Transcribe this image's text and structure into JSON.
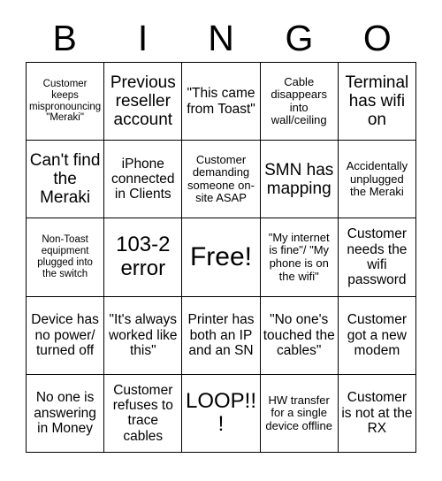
{
  "card": {
    "title_letters": [
      "B",
      "I",
      "N",
      "G",
      "O"
    ],
    "columns": 5,
    "rows": 5,
    "free_space_label": "Free!",
    "colors": {
      "background": "#ffffff",
      "text": "#000000",
      "gridline": "#000000"
    },
    "cells": [
      [
        {
          "text": "Customer keeps mispronouncing \"Meraki\"",
          "size": "xs"
        },
        {
          "text": "Previous reseller account",
          "size": "l"
        },
        {
          "text": "\"This came from Toast\"",
          "size": "m"
        },
        {
          "text": "Cable disappears into wall/ceiling",
          "size": "s"
        },
        {
          "text": "Terminal has wifi on",
          "size": "l"
        }
      ],
      [
        {
          "text": "Can't find the Meraki",
          "size": "l"
        },
        {
          "text": "iPhone connected in Clients",
          "size": "m"
        },
        {
          "text": "Customer demanding someone on-site ASAP",
          "size": "s"
        },
        {
          "text": "SMN has mapping",
          "size": "l"
        },
        {
          "text": "Accidentally unplugged the Meraki",
          "size": "s"
        }
      ],
      [
        {
          "text": "Non-Toast equipment plugged into the switch",
          "size": "xs"
        },
        {
          "text": "103-2 error",
          "size": "xl"
        },
        {
          "text": "Free!",
          "size": "xxl"
        },
        {
          "text": "\"My internet is fine\"/ \"My phone is on the wifi\"",
          "size": "s"
        },
        {
          "text": "Customer needs the wifi password",
          "size": "m"
        }
      ],
      [
        {
          "text": "Device has no power/ turned off",
          "size": "m"
        },
        {
          "text": "\"It's always worked like this\"",
          "size": "m"
        },
        {
          "text": "Printer has both an IP and an SN",
          "size": "m"
        },
        {
          "text": "\"No one's touched the cables\"",
          "size": "m"
        },
        {
          "text": "Customer got a new modem",
          "size": "m"
        }
      ],
      [
        {
          "text": "No one is answering in Money",
          "size": "m"
        },
        {
          "text": "Customer refuses to trace cables",
          "size": "m"
        },
        {
          "text": "LOOP!!!",
          "size": "xl"
        },
        {
          "text": "HW transfer for a single device offline",
          "size": "s"
        },
        {
          "text": "Customer is not at the RX",
          "size": "m"
        }
      ]
    ]
  }
}
